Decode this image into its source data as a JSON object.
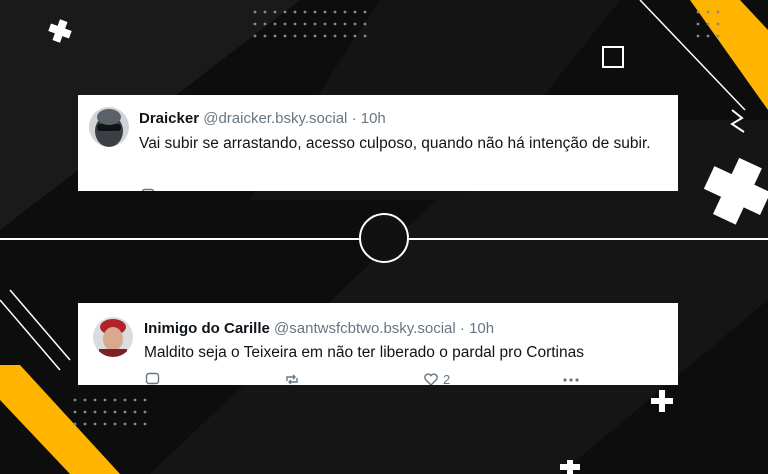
{
  "colors": {
    "background": "#0d0d0d",
    "accent": "#ffb400",
    "card": "#ffffff",
    "text": "#0f1419",
    "muted": "#687684"
  },
  "posts": [
    {
      "name": "Draicker",
      "handle": "@draicker.bsky.social",
      "separator": "·",
      "time": "10h",
      "text": "Vai subir se arrastando, acesso culposo, quando não há intenção de subir."
    },
    {
      "name": "Inimigo do Carille",
      "handle": "@santwsfcbtwo.bsky.social",
      "separator": "·",
      "time": "10h",
      "text": "Maldito seja o Teixeira em não ter liberado o pardal pro Cortinas",
      "like_count": "2",
      "actions": [
        "reply-icon",
        "repost-icon",
        "like-icon",
        "more-icon"
      ]
    }
  ]
}
